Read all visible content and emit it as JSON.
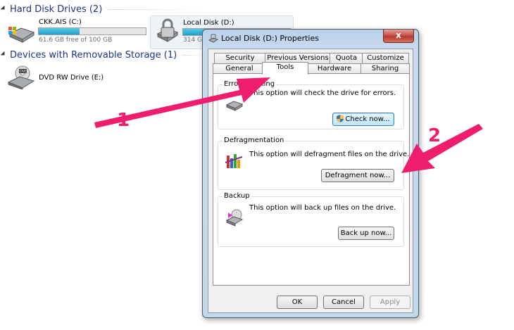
{
  "explorer": {
    "groups": [
      {
        "title": "Hard Disk Drives (2)"
      },
      {
        "title": "Devices with Removable Storage (1)"
      }
    ],
    "drives": [
      {
        "name": "CKK.AIS (C:)",
        "free_text": "61.6 GB free of 100 GB",
        "usage_fraction": 0.38
      },
      {
        "name": "Local Disk (D:)",
        "free_text": "314 GB",
        "usage_fraction": 0.3
      },
      {
        "name": "DVD RW Drive (E:)"
      }
    ]
  },
  "dialog": {
    "title": "Local Disk (D:) Properties",
    "close_label": "x",
    "tabs_row1": [
      "Security",
      "Previous Versions",
      "Quota",
      "Customize"
    ],
    "tabs_row2": [
      "General",
      "Tools",
      "Hardware",
      "Sharing"
    ],
    "active_tab": "Tools",
    "sections": {
      "error_checking": {
        "title": "Error-checking",
        "text": "This option will check the drive for errors.",
        "button": "Check now..."
      },
      "defrag": {
        "title": "Defragmentation",
        "text": "This option will defragment files on the drive.",
        "button": "Defragment now..."
      },
      "backup": {
        "title": "Backup",
        "text": "This option will back up files on the drive.",
        "button": "Back up now..."
      }
    },
    "footer": {
      "ok": "OK",
      "cancel": "Cancel",
      "apply": "Apply"
    }
  },
  "annotations": {
    "callout_1": "1",
    "callout_2": "2",
    "arrow_color": "#ef1d6e"
  }
}
